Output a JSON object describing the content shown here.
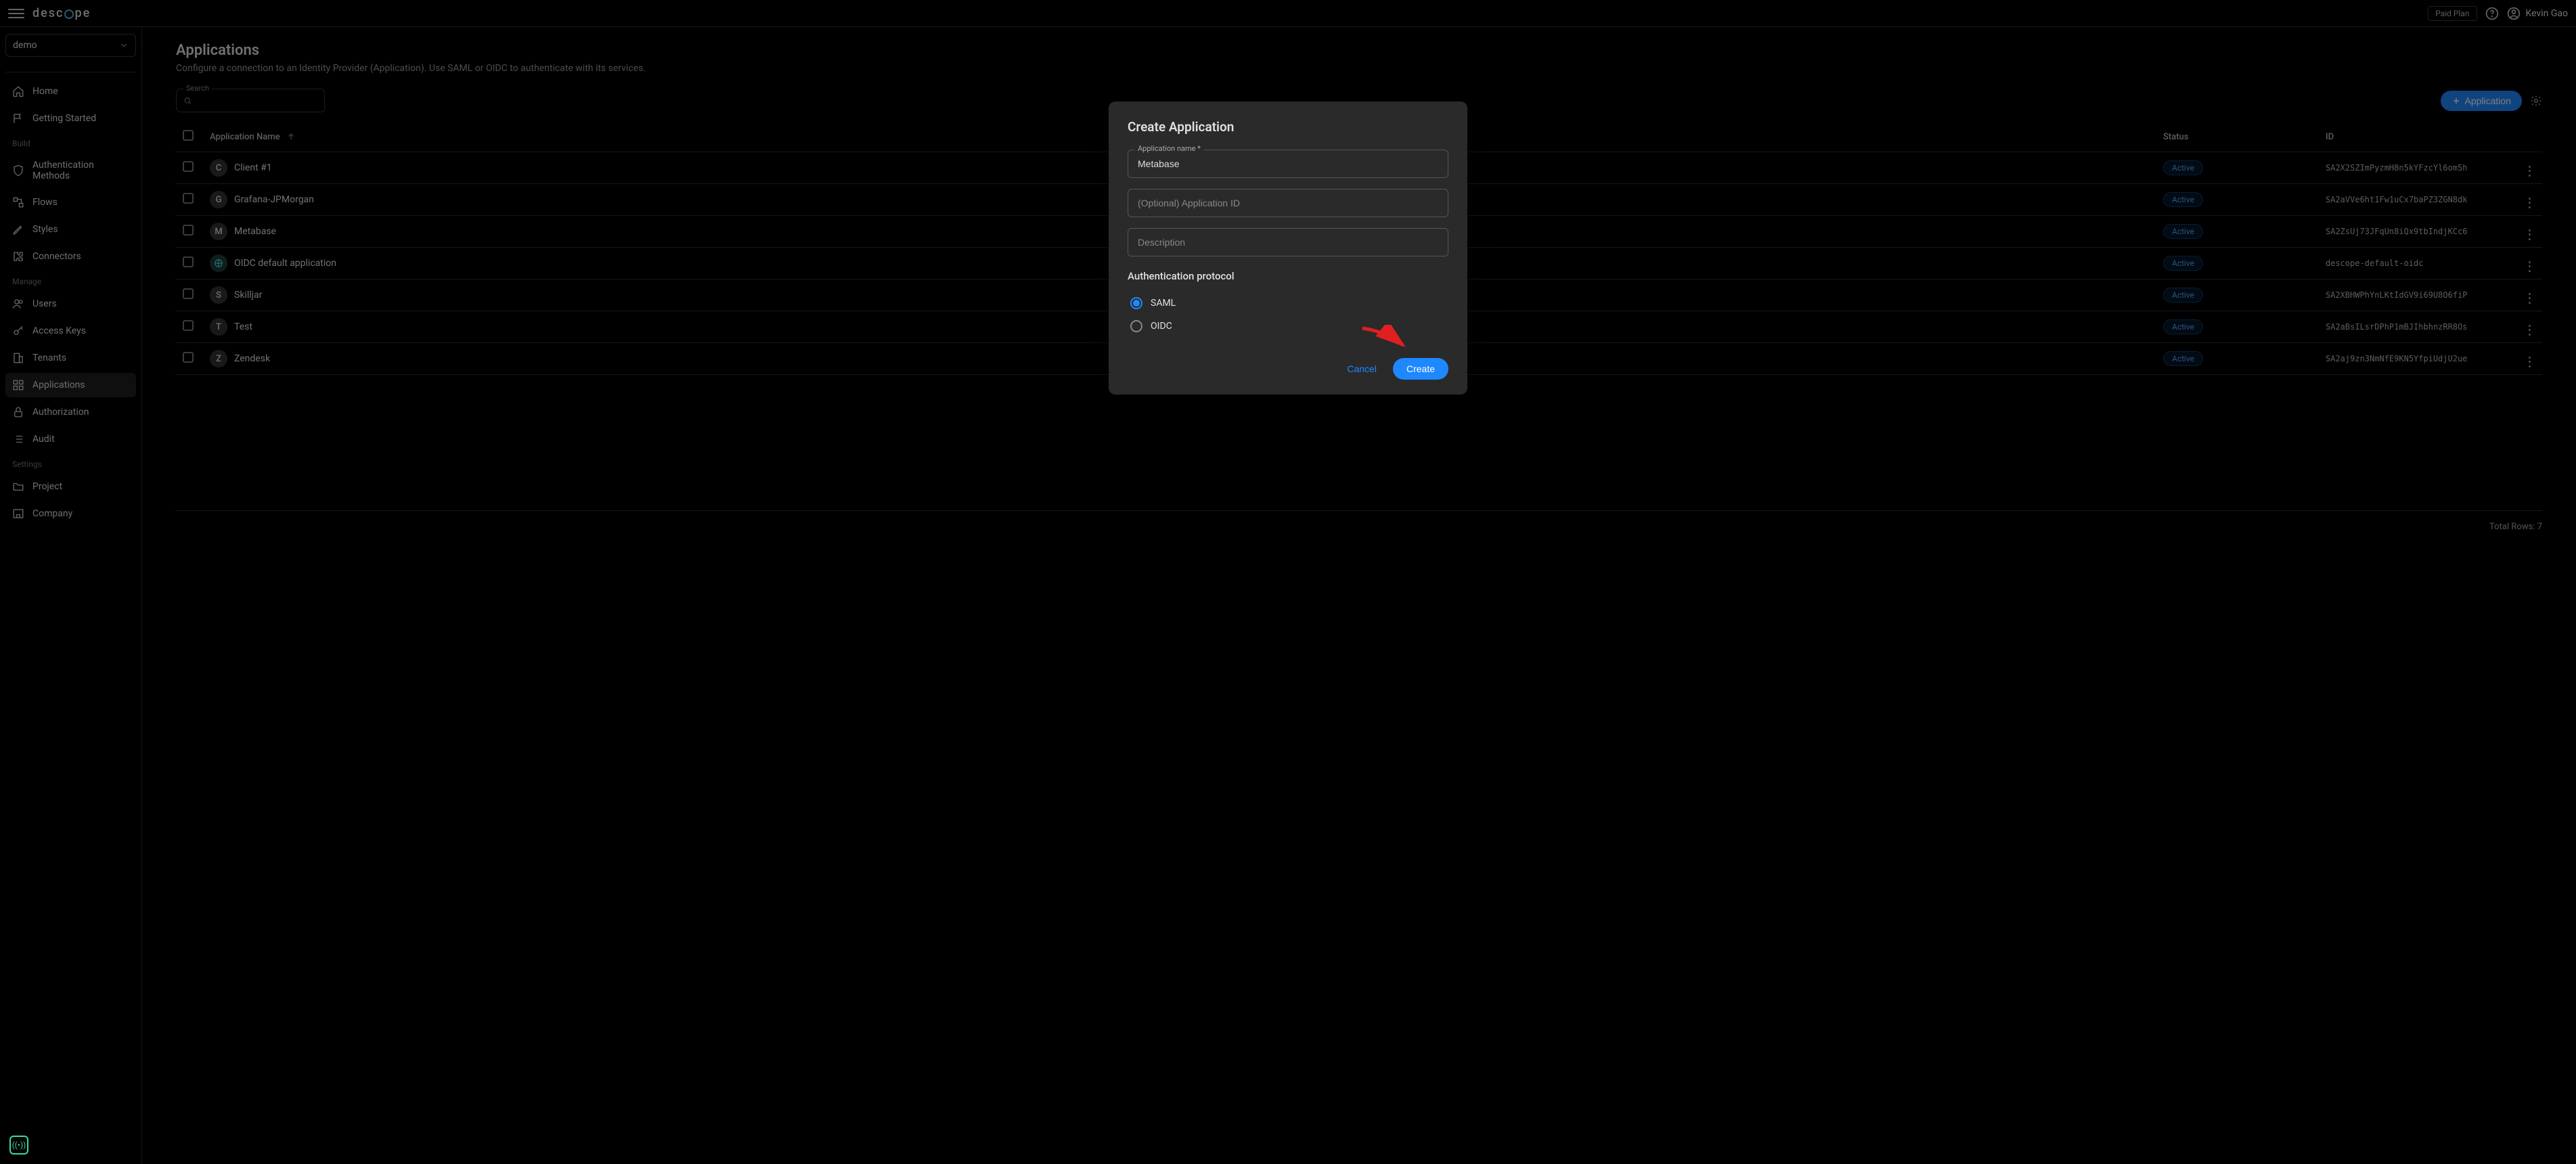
{
  "topbar": {
    "logo_text_pre": "desc",
    "logo_text_post": "pe",
    "paid_plan": "Paid Plan",
    "user_name": "Kevin Gao"
  },
  "sidebar": {
    "project": "demo",
    "items": {
      "home": "Home",
      "getting_started": "Getting Started",
      "build_label": "Build",
      "auth_methods": "Authentication Methods",
      "flows": "Flows",
      "styles": "Styles",
      "connectors": "Connectors",
      "manage_label": "Manage",
      "users": "Users",
      "access_keys": "Access Keys",
      "tenants": "Tenants",
      "applications": "Applications",
      "authorization": "Authorization",
      "audit": "Audit",
      "settings_label": "Settings",
      "project_item": "Project",
      "company": "Company"
    }
  },
  "page": {
    "title": "Applications",
    "subtitle": "Configure a connection to an Identity Provider (Application). Use SAML or OIDC to authenticate with its services.",
    "search_label": "Search",
    "add_button": "Application"
  },
  "table": {
    "headers": {
      "name": "Application Name",
      "status": "Status",
      "id": "ID"
    },
    "rows": [
      {
        "initial": "C",
        "name": "Client #1",
        "status": "Active",
        "id": "SA2X2SZImPyzmH8n5kYFzcYl6om5h"
      },
      {
        "initial": "G",
        "name": "Grafana-JPMorgan",
        "status": "Active",
        "id": "SA2aVVe6ht1Fw1uCx7baPZ3ZGN8dk"
      },
      {
        "initial": "M",
        "name": "Metabase",
        "status": "Active",
        "id": "SA2ZsUj73JFqUn8iQx9tbIndjKCc6"
      },
      {
        "initial": "",
        "name": "OIDC default application",
        "status": "Active",
        "id": "descope-default-oidc",
        "special": "oidc"
      },
      {
        "initial": "S",
        "name": "Skilljar",
        "status": "Active",
        "id": "SA2XBHWPhYnLKtIdGV9i69U8O6fiP"
      },
      {
        "initial": "T",
        "name": "Test",
        "status": "Active",
        "id": "SA2aBsILsrDPhP1mBJIhbhnzRR8Os"
      },
      {
        "initial": "Z",
        "name": "Zendesk",
        "status": "Active",
        "id": "SA2aj9zn3NmNfE9KN5YfpiUdjU2ue"
      }
    ],
    "footer_label": "Total Rows:",
    "footer_count": "7"
  },
  "modal": {
    "title": "Create Application",
    "name_label": "Application name *",
    "name_value": "Metabase",
    "id_placeholder": "(Optional) Application ID",
    "desc_placeholder": "Description",
    "protocol_label": "Authentication protocol",
    "opt_saml": "SAML",
    "opt_oidc": "OIDC",
    "cancel": "Cancel",
    "create": "Create"
  }
}
